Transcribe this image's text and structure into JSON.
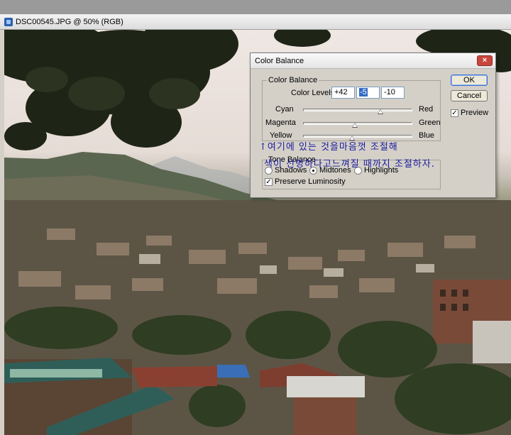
{
  "document": {
    "title": "DSC00545.JPG @ 50% (RGB)"
  },
  "dialog": {
    "title": "Color Balance",
    "close_glyph": "×",
    "color_balance_group": "Color Balance",
    "levels_label": "Color Levels:",
    "levels": [
      "+42",
      "-5",
      "-10"
    ],
    "sliders": [
      {
        "left": "Cyan",
        "right": "Red",
        "value": 42
      },
      {
        "left": "Magenta",
        "right": "Green",
        "value": -5
      },
      {
        "left": "Yellow",
        "right": "Blue",
        "value": -10
      }
    ],
    "tone_balance_group": "Tone Balance",
    "tones": [
      {
        "label": "Shadows",
        "selected": false
      },
      {
        "label": "Midtones",
        "selected": true
      },
      {
        "label": "Highlights",
        "selected": false
      }
    ],
    "preserve_luminosity": {
      "label": "Preserve Luminosity",
      "checked": true
    },
    "ok_label": "OK",
    "cancel_label": "Cancel",
    "preview": {
      "label": "Preview",
      "checked": true
    }
  },
  "annotation": {
    "line1": "↑여기에 있는 것을마음껏 조절해",
    "line2": "색이 선명하다고느껴질 때까지 조절하자."
  },
  "colors": {
    "annotation_ink": "#1a1a9e",
    "default_button_border": "#3c6fd1",
    "close_button": "#c9463d"
  }
}
